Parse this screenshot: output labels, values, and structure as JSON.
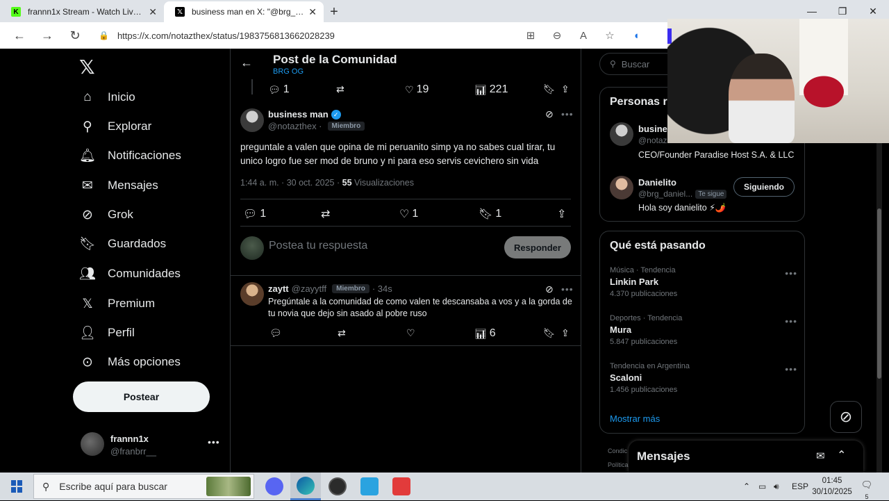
{
  "browser": {
    "tabs": [
      {
        "title": "frannn1x Stream - Watch Live on",
        "active": false
      },
      {
        "title": "business man en X: \"@brg_danielit",
        "active": true
      }
    ],
    "url": "https://x.com/notazthex/status/1983756813662028239"
  },
  "nav": {
    "items": [
      {
        "label": "Inicio",
        "icon": "home-icon"
      },
      {
        "label": "Explorar",
        "icon": "search-icon"
      },
      {
        "label": "Notificaciones",
        "icon": "bell-icon"
      },
      {
        "label": "Mensajes",
        "icon": "mail-icon"
      },
      {
        "label": "Grok",
        "icon": "grok-icon"
      },
      {
        "label": "Guardados",
        "icon": "bookmark-icon"
      },
      {
        "label": "Comunidades",
        "icon": "people-icon"
      },
      {
        "label": "Premium",
        "icon": "x-icon"
      },
      {
        "label": "Perfil",
        "icon": "person-icon"
      },
      {
        "label": "Más opciones",
        "icon": "more-circle-icon"
      }
    ],
    "post_button": "Postear",
    "account": {
      "name": "frannn1x",
      "handle": "@franbrr__"
    }
  },
  "header": {
    "title": "Post de la Comunidad",
    "community": "BRG OG"
  },
  "parent_actions": {
    "replies": "1",
    "likes": "19",
    "views": "221"
  },
  "post": {
    "author": "business man",
    "handle": "@notazthex ·",
    "badge": "Miembro",
    "text": "preguntale a valen que opina de mi peruanito simp ya no sabes cual tirar, tu unico logro fue ser mod de bruno y ni para eso servis cevichero sin vida",
    "time": "1:44 a. m. · 30 oct. 2025 ·",
    "views_count": "55",
    "views_label": "Visualizaciones",
    "replies": "1",
    "likes": "1",
    "bookmarks": "1"
  },
  "reply_box": {
    "placeholder": "Postea tu respuesta",
    "button": "Responder"
  },
  "comment": {
    "author": "zaytt",
    "handle": "@zayytff",
    "badge": "Miembro",
    "time": "· 34s",
    "text": "Pregúntale a la comunidad de como valen te descansaba a vos y a la gorda de tu novia que dejo sin asado al pobre ruso",
    "views": "6"
  },
  "right": {
    "search_placeholder": "Buscar",
    "people_title": "Personas r",
    "people": [
      {
        "name": "busines",
        "handle": "@notaz",
        "bio": "CEO/Founder Paradise Host S.A. & LLC"
      },
      {
        "name": "Danielito",
        "handle": "@brg_daniel...",
        "follows_you": "Te sigue",
        "button": "Siguiendo",
        "bio": "Hola soy danielito ⚡🌶️"
      }
    ],
    "trends_title": "Qué está pasando",
    "trends": [
      {
        "context": "Música · Tendencia",
        "name": "Linkin Park",
        "count": "4.370 publicaciones"
      },
      {
        "context": "Deportes · Tendencia",
        "name": "Mura",
        "count": "5.847 publicaciones"
      },
      {
        "context": "Tendencia en Argentina",
        "name": "Scaloni",
        "count": "1.456 publicaciones"
      }
    ],
    "show_more": "Mostrar más",
    "footer1": "Condic",
    "footer2": "Política",
    "messages_title": "Mensajes"
  },
  "taskbar": {
    "search_placeholder": "Escribe aquí para buscar",
    "lang": "ESP",
    "time": "01:45",
    "date": "30/10/2025",
    "notif_count": "5"
  }
}
